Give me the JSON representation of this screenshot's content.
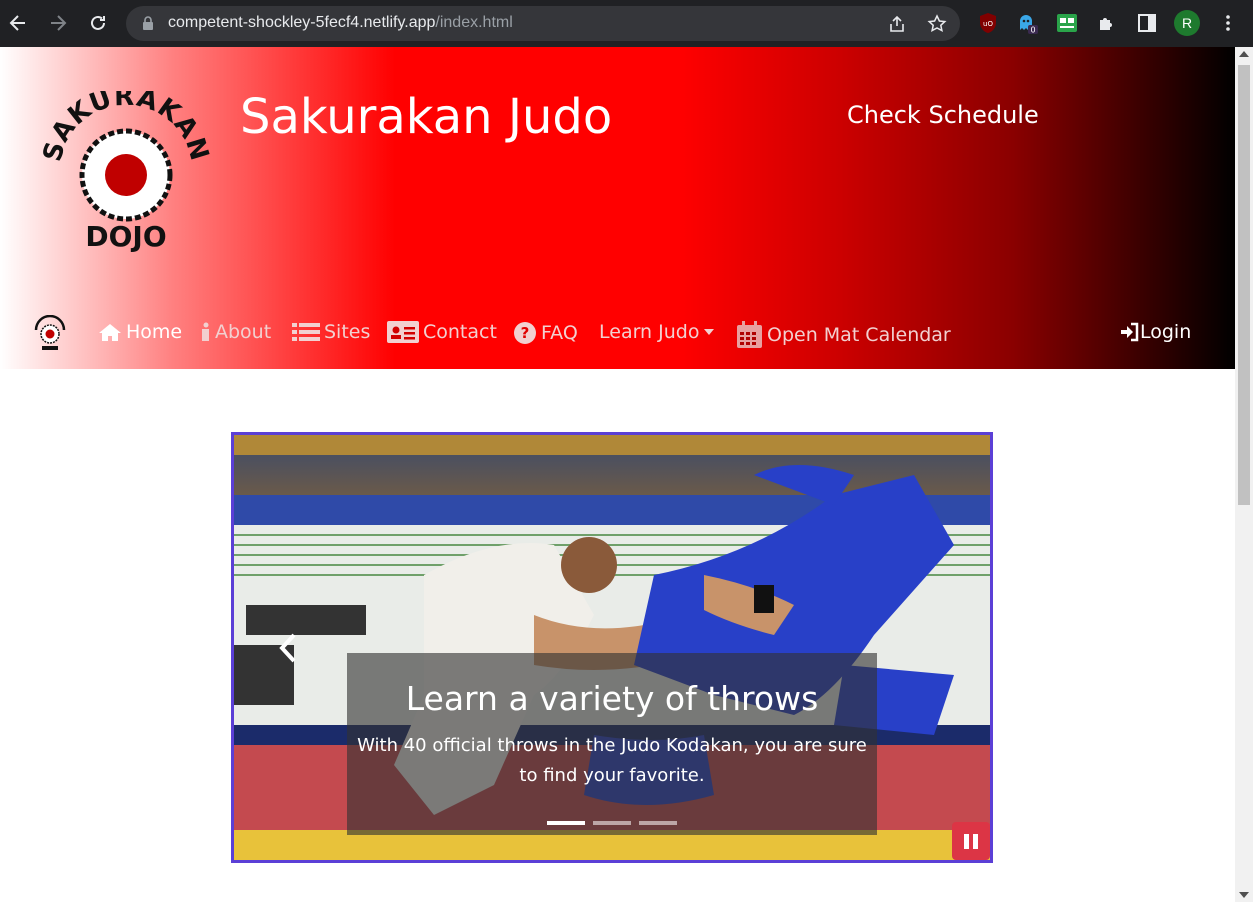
{
  "browser": {
    "url_host": "competent-shockley-5fecf4.netlify.app",
    "url_path": "/index.html",
    "badge_count": "0",
    "profile_initial": "R"
  },
  "header": {
    "title": "Sakurakan Judo",
    "schedule_link": "Check Schedule",
    "logo_text_top": "SAKURAKAN",
    "logo_text_bottom": "DOJO"
  },
  "nav": {
    "items": [
      {
        "label": "Home",
        "icon": "home-icon"
      },
      {
        "label": "About",
        "icon": "info-icon"
      },
      {
        "label": "Sites",
        "icon": "list-icon"
      },
      {
        "label": "Contact",
        "icon": "id-card-icon"
      },
      {
        "label": "FAQ",
        "icon": "question-circle-icon"
      },
      {
        "label": "Learn Judo",
        "icon": "caret-down-icon"
      },
      {
        "label": "Open Mat Calendar",
        "icon": "calendar-icon"
      }
    ],
    "login": "Login"
  },
  "carousel": {
    "caption_title": "Learn a variety of throws",
    "caption_text": "With 40 official throws in the Judo Kodakan, you are sure to find your favorite.",
    "active_slide": 1,
    "slide_count": 3
  },
  "colors": {
    "brand_red": "#ff0000",
    "carousel_border": "#5b3fd6",
    "pause_button": "#dc3545"
  }
}
